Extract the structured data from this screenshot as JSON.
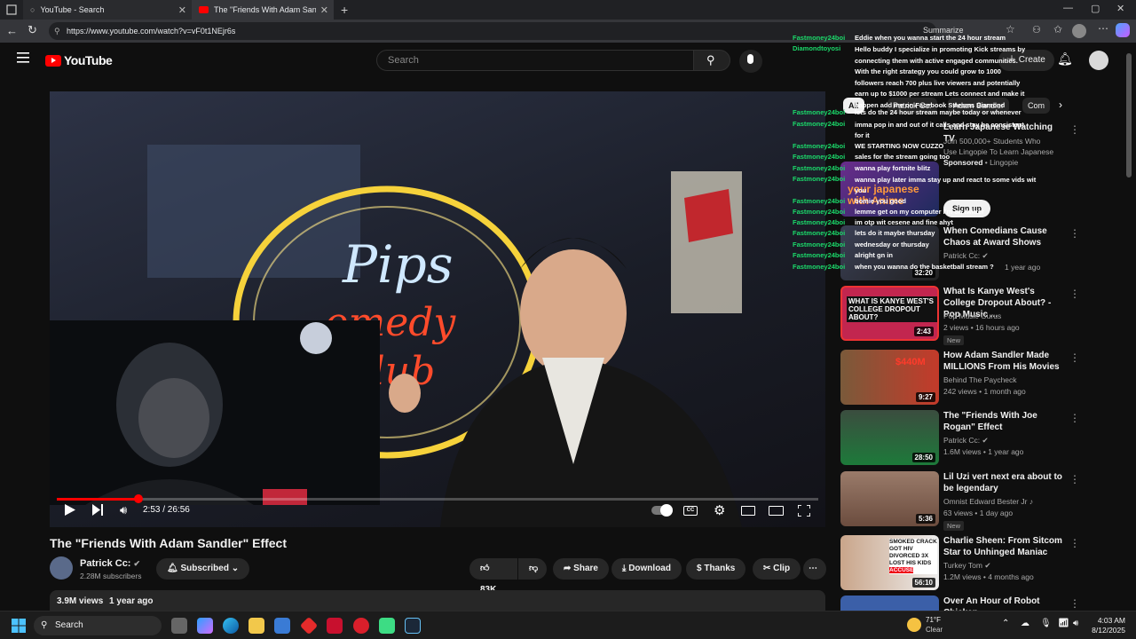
{
  "browser": {
    "tabs": [
      {
        "title": "YouTube - Search"
      },
      {
        "title": "The \"Friends With Adam Sandler\""
      }
    ],
    "url": "https://www.youtube.com/watch?v=vF0t1NEjr6s",
    "summarize_label": "Summarize"
  },
  "header": {
    "logo_text": "YouTube",
    "search_placeholder": "Search",
    "create_label": "Create"
  },
  "player": {
    "time": "2:53 / 26:56",
    "progress": 0.107
  },
  "video": {
    "title": "The \"Friends With Adam Sandler\" Effect",
    "channel": "Patrick Cc:",
    "subscribers": "2.28M subscribers",
    "subscribed_label": "Subscribed",
    "likes": "83K",
    "share_label": "Share",
    "download_label": "Download",
    "thanks_label": "Thanks",
    "clip_label": "Clip",
    "views": "3.9M views",
    "age": "1 year ago"
  },
  "chips": [
    "All",
    "Adam Sandler",
    "Patrick Cc:",
    "Com"
  ],
  "ad": {
    "title": "Learn Japanese Watching TV",
    "desc": "Join 500,000+ Students Who Use Lingopie To Learn Japanese",
    "sponsored": "Sponsored",
    "advertiser": "Lingopie",
    "signup_label": "Sign up",
    "thumb_text": "your japanese with Anime"
  },
  "recommendations": [
    {
      "title": "When Comedians Cause Chaos at Award Shows",
      "channel": "Patrick Cc:",
      "meta": "1 year ago",
      "duration": "32:20",
      "new": ""
    },
    {
      "title": "What Is Kanye West's College Dropout About? - Pop Music ...",
      "channel": "Pop Music Gurus",
      "meta": "2 views • 16 hours ago",
      "duration": "2:43",
      "new": "New"
    },
    {
      "title": "How Adam Sandler Made MILLIONS From His Movies",
      "channel": "Behind The Paycheck",
      "meta": "242 views • 1 month ago",
      "duration": "9:27",
      "new": ""
    },
    {
      "title": "The \"Friends With Joe Rogan\" Effect",
      "channel": "Patrick Cc:",
      "meta": "1.6M views • 1 year ago",
      "duration": "28:50",
      "new": ""
    },
    {
      "title": "Lil Uzi vert next era about to be legendary",
      "channel": "Omnist Edward Bester Jr",
      "meta": "63 views • 1 day ago",
      "duration": "5:36",
      "new": "New"
    },
    {
      "title": "Charlie Sheen: From Sitcom Star to Unhinged Maniac",
      "channel": "Turkey Tom",
      "meta": "1.2M views • 4 months ago",
      "duration": "56:10",
      "new": ""
    },
    {
      "title": "Over An Hour of Robot Chicken",
      "channel": "",
      "meta": "",
      "duration": "",
      "new": ""
    }
  ],
  "chat": [
    {
      "user": "Fastmoney24boi",
      "text": "Eddie when you wanna start the 24 hour stream"
    },
    {
      "user": "Diamondtoyosi",
      "text": "Hello buddy I specialize in promoting Kick streams by connecting them with active engaged communities. With the right strategy you could grow to 1000 followers reach 700 plus live viewers and potentially earn up to $1000 per stream Lets connect and make it happen add me on Facebook Streams Diamond"
    },
    {
      "user": "Fastmoney24boi",
      "text": "lets do the 24 hour stream maybe today or whenever"
    },
    {
      "user": "Fastmoney24boi",
      "text": "imma pop in and out of it calls and stay be consistent for it"
    },
    {
      "user": "Fastmoney24boi",
      "text": "WE STARTING NOW CUZZO"
    },
    {
      "user": "Fastmoney24boi",
      "text": "sales for the stream going too"
    },
    {
      "user": "Fastmoney24boi",
      "text": "wanna play fortnite blitz"
    },
    {
      "user": "Fastmoney24boi",
      "text": "wanna play later imma stay up and react to some vids wit you"
    },
    {
      "user": "Fastmoney24boi",
      "text": "bomie you good"
    },
    {
      "user": "Fastmoney24boi",
      "text": "lemme get on my computer I'm on twitter"
    },
    {
      "user": "Fastmoney24boi",
      "text": "im otp wit cesene and fine ahyt"
    },
    {
      "user": "Fastmoney24boi",
      "text": "lets do it maybe thursday"
    },
    {
      "user": "Fastmoney24boi",
      "text": "wednesday or thursday"
    },
    {
      "user": "Fastmoney24boi",
      "text": "alright gn in"
    },
    {
      "user": "Fastmoney24boi",
      "text": "when you wanna do the basketball stream ?"
    }
  ],
  "taskbar": {
    "search_label": "Search",
    "weather_temp": "71°F",
    "weather_desc": "Clear",
    "time": "4:03 AM",
    "date": "8/12/2025"
  },
  "colors": {
    "accent": "#ff0000",
    "chat_user": "#1bd96a",
    "background": "#0f0f0f"
  }
}
